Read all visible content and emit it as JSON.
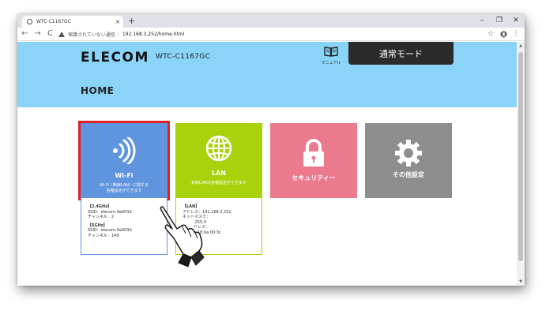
{
  "browser": {
    "tab_title": "WTC-C1167GC",
    "tab_close": "×",
    "new_tab": "+",
    "minimize": "–",
    "restore": "❐",
    "close": "✕",
    "back": "←",
    "forward": "→",
    "reload": "C",
    "security_text": "保護されていない通信",
    "separator": "|",
    "url": "192.168.3.252/home.html",
    "star": "☆",
    "menu": "⋮"
  },
  "header": {
    "logo": "ELECOM",
    "model": "WTC-C1167GC",
    "manual_label": "マニュアル",
    "mode_button": "通常モード",
    "page_title": "HOME"
  },
  "cards": {
    "wifi": {
      "title": "Wi-Fi",
      "desc_line1": "Wi-Fi（無線LAN）に関する",
      "desc_line2": "各種設定ができます"
    },
    "lan": {
      "title": "LAN",
      "desc_line1": "有線LANの各種設定ができます"
    },
    "security": {
      "title": "セキュリティー"
    },
    "other": {
      "title": "その他設定"
    }
  },
  "wifi_info": {
    "band1": "【2.4GHz】",
    "ssid1": "SSID：elecom-9a003d",
    "channel1": "チャンネル：2",
    "band2": "【5GHz】",
    "ssid2": "SSID：elecom-9a003d",
    "channel2": "チャンネル：149"
  },
  "lan_info": {
    "header": "【LAN】",
    "line1": "アドレス：192.168.3.252",
    "line2": "ネットマスク：",
    "line3": ".255.0",
    "line4": "ドレス：",
    "line5": "b:18:9a:00:3c"
  },
  "colors": {
    "header_bg": "#89d4f8",
    "wifi": "#5f95de",
    "lan": "#a9d20c",
    "security": "#ec7a8e",
    "other": "#8e8e8e",
    "highlight": "#e21f26"
  }
}
